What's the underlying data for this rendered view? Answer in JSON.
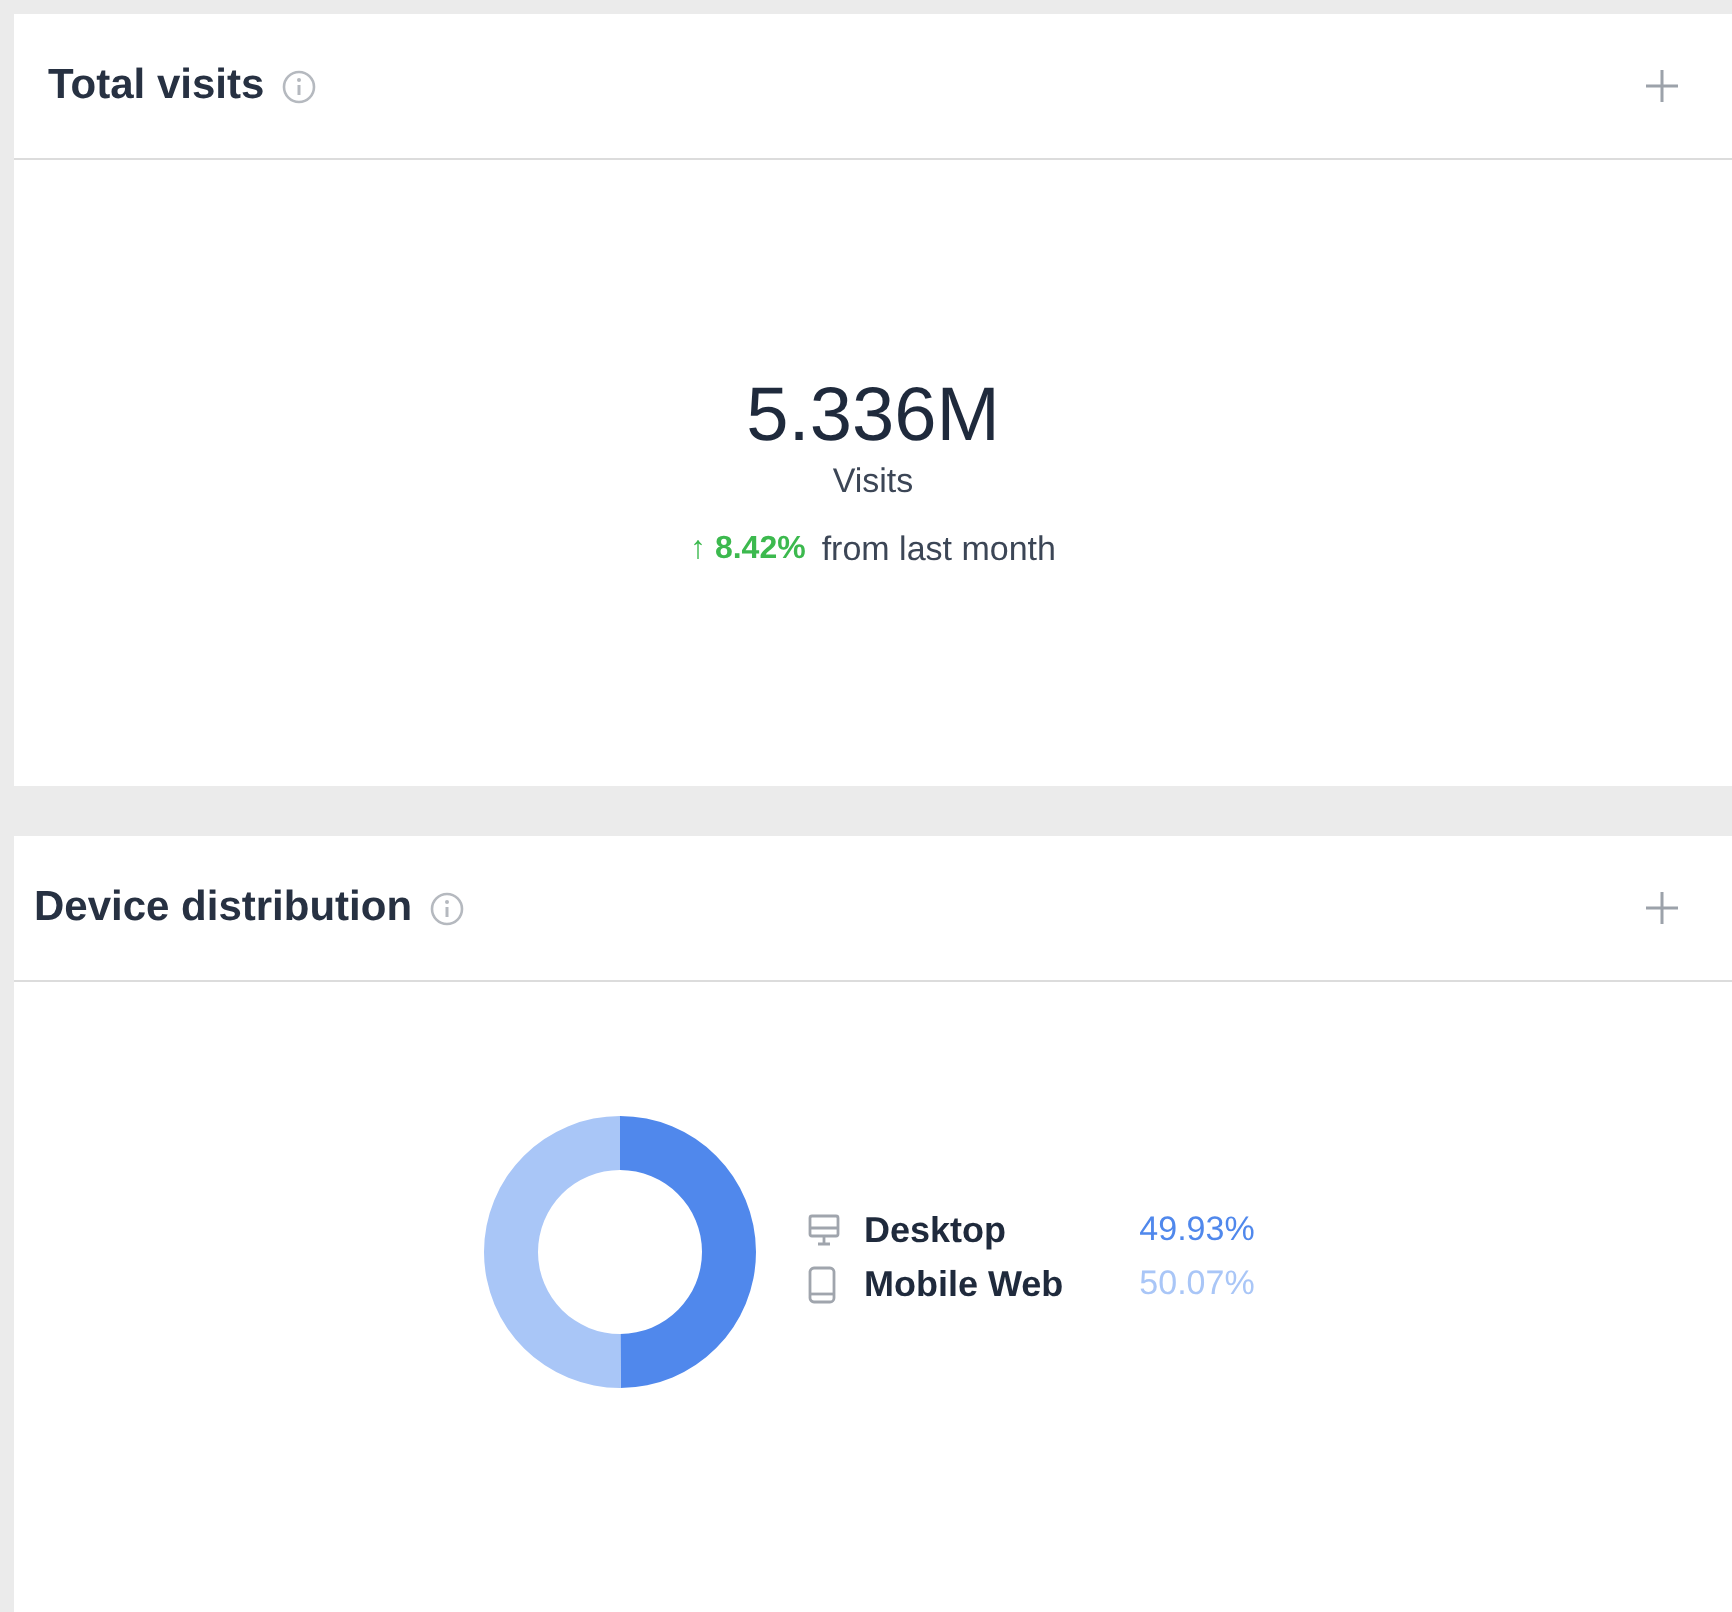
{
  "visits_card": {
    "title": "Total visits",
    "value": "5.336M",
    "unit": "Visits",
    "change": "8.42%",
    "change_arrow": "↑",
    "positive": true,
    "change_note": "from last month"
  },
  "device_card": {
    "title": "Device distribution",
    "devices": [
      {
        "kind": "desktop",
        "share": "49.93%",
        "color": "#5088ec"
      },
      {
        "kind": "mobile",
        "share": "50.07%",
        "color": "#a9c6f7"
      }
    ],
    "chart_data": {
      "type": "donut",
      "categories": [
        "Desktop",
        "Mobile Web"
      ],
      "values": [
        49.93,
        50.07
      ]
    }
  }
}
